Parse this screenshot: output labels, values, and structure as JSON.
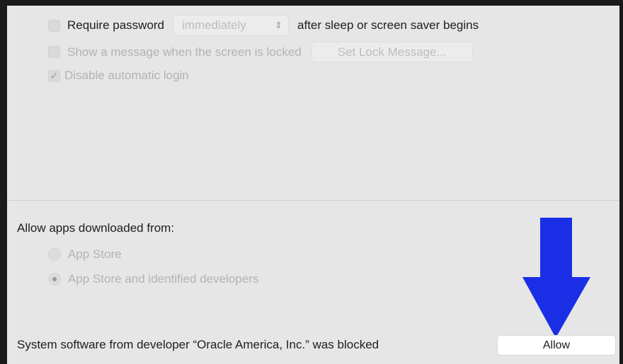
{
  "password": {
    "require_label": "Require password",
    "delay_value": "immediately",
    "suffix": "after sleep or screen saver begins",
    "require_checked": false
  },
  "lock_message": {
    "label": "Show a message when the screen is locked",
    "button": "Set Lock Message...",
    "checked": false
  },
  "auto_login": {
    "label": "Disable automatic login",
    "checked": true,
    "check_glyph": "✓"
  },
  "gatekeeper": {
    "heading": "Allow apps downloaded from:",
    "options": [
      {
        "label": "App Store",
        "selected": false
      },
      {
        "label": "App Store and identified developers",
        "selected": true
      }
    ]
  },
  "blocked": {
    "message": "System software from developer “Oracle America, Inc.” was blocked",
    "allow_button": "Allow"
  },
  "annotation": {
    "arrow_color": "#1a2ee6",
    "arrow_direction": "down"
  },
  "icons": {
    "chevron": "up-down-chevron-icon"
  }
}
